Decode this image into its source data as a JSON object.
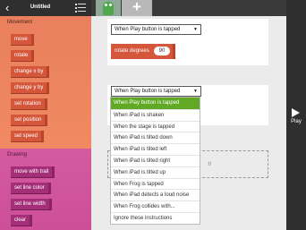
{
  "app": {
    "title": "Untitled",
    "back_glyph": "‹"
  },
  "palette": {
    "movement": {
      "title": "Movement",
      "blocks": [
        "move",
        "rotate",
        "change x by",
        "change y by",
        "set rotation",
        "set position",
        "set speed"
      ]
    },
    "drawing": {
      "title": "Drawing",
      "blocks": [
        "move with trail",
        "set line color",
        "set line width",
        "clear"
      ]
    }
  },
  "tabs": {
    "add_glyph": "+"
  },
  "scripts": {
    "card1_trigger": "When Play button is tapped",
    "rotate_label": "rotate",
    "degrees_label": "degrees",
    "degrees_value": "90",
    "card2_trigger": "When Play button is tapped",
    "drop_hint": "t!"
  },
  "dropdown": {
    "items": [
      "When Play button is tapped",
      "When iPad is shaken",
      "When the stage is tapped",
      "When iPad is tilted down",
      "When iPad is tilted left",
      "When iPad is tilted right",
      "When iPad is tilted up",
      "When Frog is tapped",
      "When iPad detects a loud noise",
      "When Frog collides with...",
      "Ignore these instructions"
    ],
    "selected_index": 0
  },
  "play": {
    "label": "Play"
  },
  "colors": {
    "movement_bg": "#f08a62",
    "movement_block": "#d4573c",
    "drawing_bg": "#d55aa0",
    "drawing_block": "#a42f78",
    "menu_selected": "#61a824",
    "dark_bar": "#2f2f2f"
  },
  "icons": [
    "back-chevron-icon",
    "list-icon",
    "frog-sprite-icon",
    "plus-icon",
    "play-icon",
    "dropdown-arrow-icon"
  ]
}
